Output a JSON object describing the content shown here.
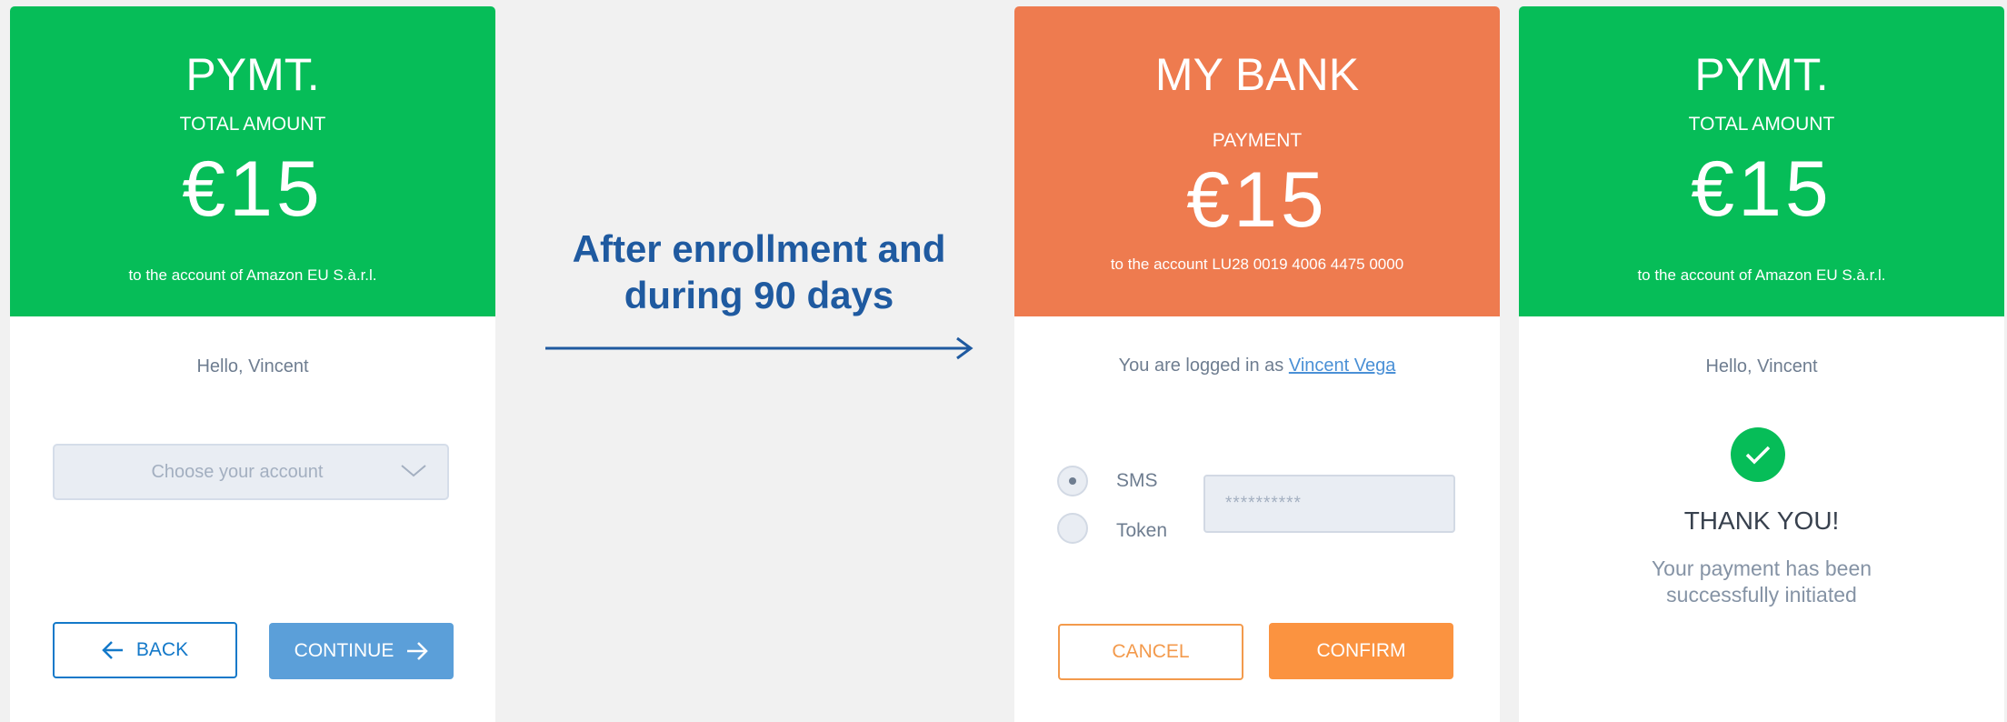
{
  "panel1": {
    "brand": "PYMT.",
    "subtitle": "TOTAL AMOUNT",
    "amount": "€15",
    "account_line": "to the account of Amazon EU S.à.r.l.",
    "greeting": "Hello, Vincent",
    "select_placeholder": "Choose your account",
    "back_label": "BACK",
    "continue_label": "CONTINUE"
  },
  "middle": {
    "text_line1": "After enrollment  and",
    "text_line2": "during 90 days"
  },
  "panel2": {
    "brand": "MY  BANK",
    "subtitle": "PAYMENT",
    "amount": "€15",
    "account_line": "to the account  LU28 0019 4006 4475 0000",
    "logged_prefix": "You are logged in as",
    "logged_user": "Vincent Vega",
    "radio_sms": "SMS",
    "radio_token": "Token",
    "password_mask": "**********",
    "cancel_label": "CANCEL",
    "confirm_label": "CONFIRM"
  },
  "panel3": {
    "brand": "PYMT.",
    "subtitle": "TOTAL AMOUNT",
    "amount": "€15",
    "account_line": "to the account of Amazon EU S.à.r.l.",
    "greeting": "Hello, Vincent",
    "thanks": "THANK YOU!",
    "success_line1": "Your payment has been",
    "success_line2": "successfully initiated"
  },
  "colors": {
    "green": "#06bd58",
    "orange": "#ee7b4f",
    "blue_text": "#1f5aa0",
    "continue_blue": "#5b9fd9",
    "confirm_orange": "#fb9340"
  },
  "icons": [
    "chevron-down-icon",
    "arrow-left-icon",
    "arrow-right-icon",
    "long-arrow-right-icon",
    "check-icon"
  ]
}
